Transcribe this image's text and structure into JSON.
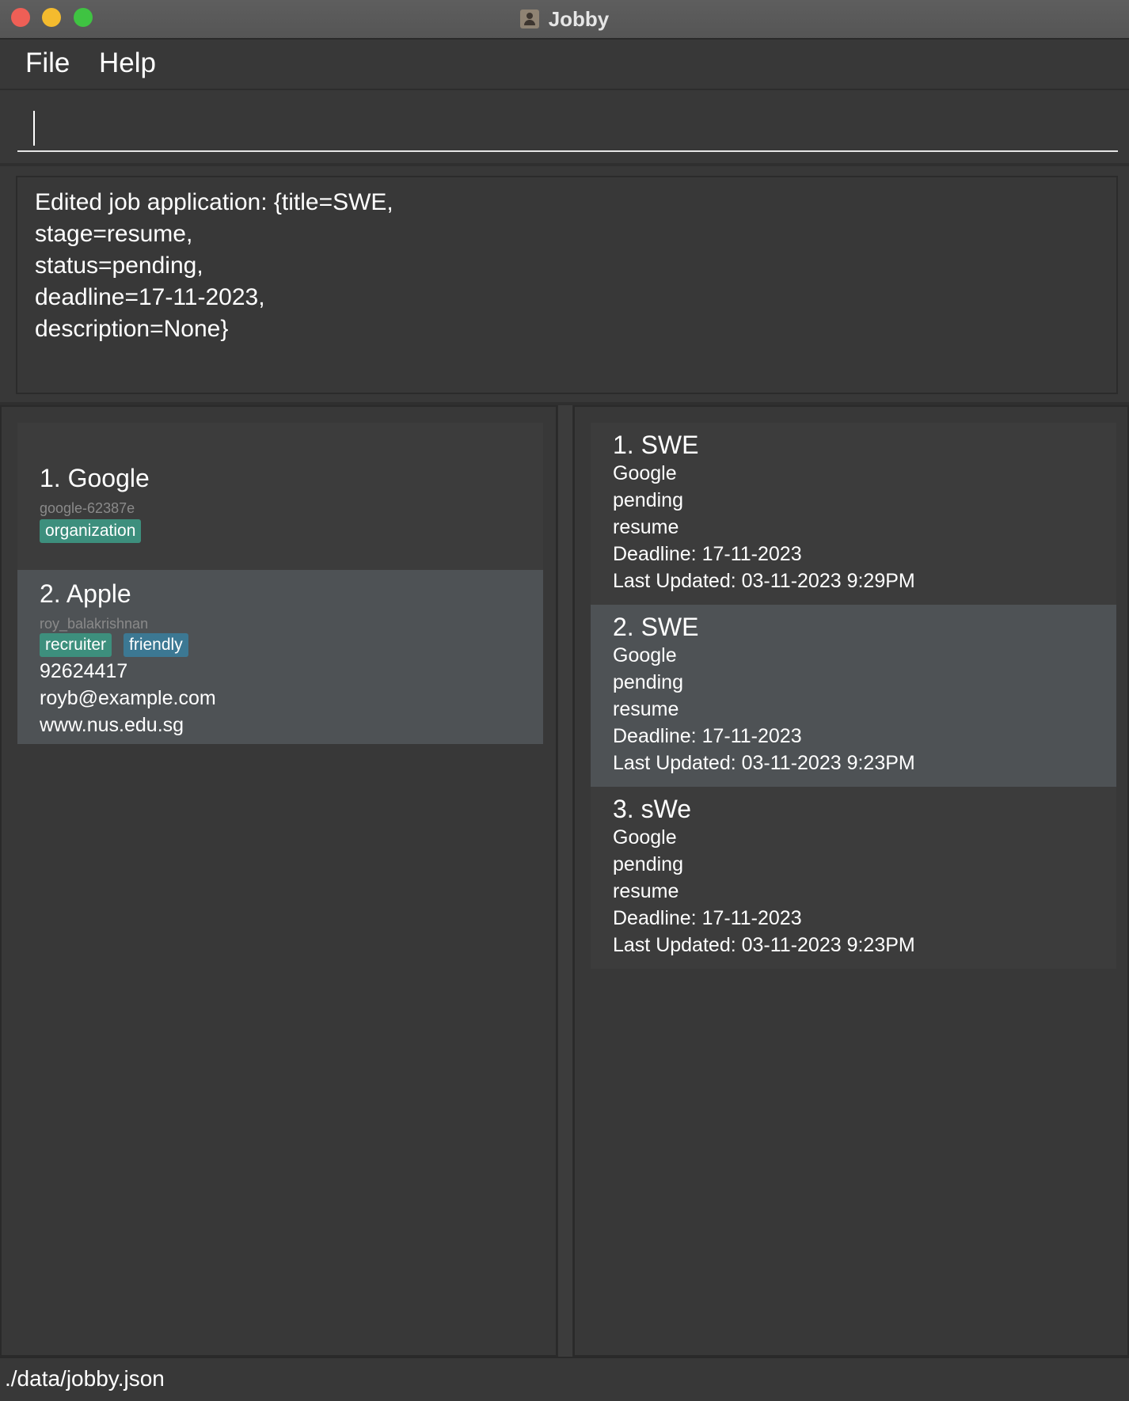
{
  "window": {
    "title": "Jobby"
  },
  "menu": {
    "file": "File",
    "help": "Help"
  },
  "command": {
    "value": ""
  },
  "result": {
    "text": "Edited job application: {title=SWE,\nstage=resume,\nstatus=pending,\ndeadline=17-11-2023,\ndescription=None}"
  },
  "contacts": [
    {
      "title": "1.  Google",
      "id": "google-62387e",
      "tags": [
        "organization"
      ],
      "phone": "",
      "email": "",
      "url": ""
    },
    {
      "title": "2.  Apple",
      "id": "roy_balakrishnan",
      "tags": [
        "recruiter",
        "friendly"
      ],
      "phone": "92624417",
      "email": "royb@example.com",
      "url": "www.nus.edu.sg"
    }
  ],
  "jobs": [
    {
      "title": "1.  SWE",
      "company": "Google",
      "status": "pending",
      "stage": "resume",
      "deadline": "Deadline: 17-11-2023",
      "updated": "Last Updated: 03-11-2023 9:29PM"
    },
    {
      "title": "2.  SWE",
      "company": "Google",
      "status": "pending",
      "stage": "resume",
      "deadline": "Deadline: 17-11-2023",
      "updated": "Last Updated: 03-11-2023 9:23PM"
    },
    {
      "title": "3.  sWe",
      "company": "Google",
      "status": "pending",
      "stage": "resume",
      "deadline": "Deadline: 17-11-2023",
      "updated": "Last Updated: 03-11-2023 9:23PM"
    }
  ],
  "status": {
    "path": "./data/jobby.json"
  },
  "colors": {
    "tag_green": "#3d8f7d",
    "tag_blue": "#3c7893",
    "selected_card": "#4e5255",
    "background": "#383838"
  }
}
